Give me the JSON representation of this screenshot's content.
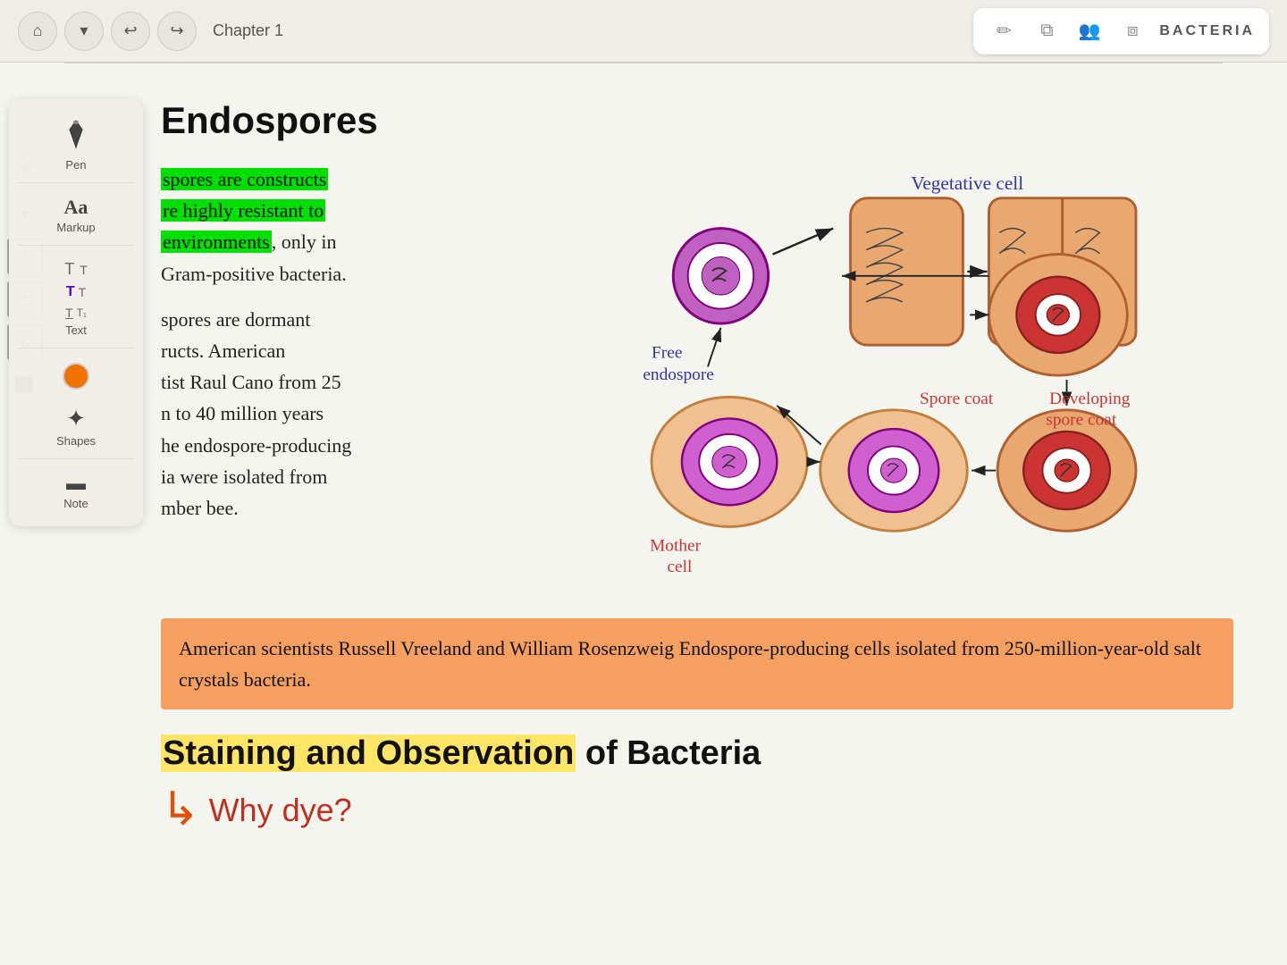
{
  "topBar": {
    "homeBtn": "⌂",
    "dropBtn": "▾",
    "undoBtn": "↩",
    "redoBtn": "↪",
    "chapterLabel": "Chapter 1",
    "icons": {
      "pencil": "✏",
      "copy": "⧉",
      "users": "👥",
      "layers": "⧈"
    },
    "bookTitle": "BACTERIA"
  },
  "toolPanel": {
    "tools": [
      {
        "id": "pen",
        "icon": "✒",
        "label": "Pen"
      },
      {
        "id": "markup",
        "icon": "Aa",
        "label": "Markup"
      },
      {
        "id": "text",
        "icon": "T",
        "label": "Text"
      },
      {
        "id": "shapes",
        "icon": "★",
        "label": "Shapes"
      },
      {
        "id": "note",
        "icon": "▬",
        "label": "Note"
      }
    ],
    "colorLabel": "orange"
  },
  "document": {
    "sectionTitle": "Endospores",
    "paragraph1": {
      "part1": "spores are constructs",
      "part2": "re highly resistant to",
      "part3": "environments",
      "part4": ", only in",
      "part5": "Gram-positive bacteria."
    },
    "paragraph2": {
      "text": "spores are dormant ructs. American tist Raul Cano from 25 n to 40 million years he endospore-producing ia were isolated from mber bee."
    },
    "orangeHighlightText": "American scientists Russell Vreeland and William Rosenzweig Endospore-producing cells isolated from 250-million-year-old salt crystals bacteria.",
    "diagram": {
      "labels": {
        "vegetativeCell": "Vegetative cell",
        "freeEndospore": "Free endospore",
        "sporeCoat": "Spore coat",
        "motherCell": "Mother cell",
        "developingSporeCoat": "Developing spore coat"
      }
    },
    "section2Title": {
      "part1": "Staining and Observation",
      "part2": " of Bacteria"
    },
    "whyDye": "Why dye?"
  }
}
